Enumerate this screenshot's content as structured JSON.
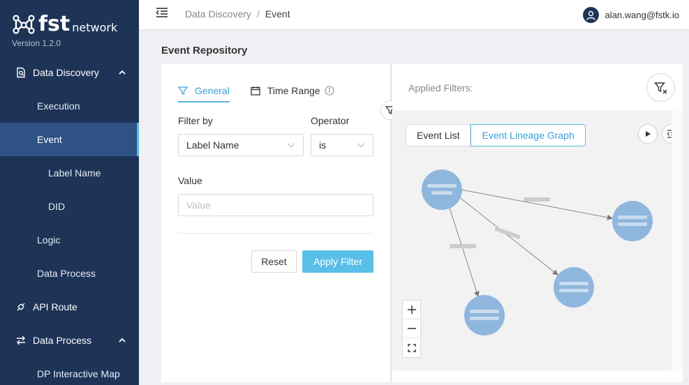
{
  "brand": {
    "name": "fst",
    "suffix": "network",
    "version": "Version 1.2.0"
  },
  "sidebar": {
    "items": [
      {
        "label": "Data Discovery",
        "level": "top",
        "icon": "search-doc-icon",
        "expanded": true
      },
      {
        "label": "Execution",
        "level": "sub"
      },
      {
        "label": "Event",
        "level": "sub",
        "active": true
      },
      {
        "label": "Label Name",
        "level": "sub2"
      },
      {
        "label": "DID",
        "level": "sub2"
      },
      {
        "label": "Logic",
        "level": "sub"
      },
      {
        "label": "Data Process",
        "level": "sub"
      },
      {
        "label": "API Route",
        "level": "top",
        "icon": "route-icon"
      },
      {
        "label": "Data Process",
        "level": "top",
        "icon": "process-icon",
        "expanded": true
      },
      {
        "label": "DP Interactive Map",
        "level": "sub"
      }
    ]
  },
  "header": {
    "breadcrumb": [
      "Data Discovery",
      "Event"
    ],
    "breadcrumb_sep": "/",
    "user_email": "alan.wang@fstk.io"
  },
  "page": {
    "title": "Event Repository"
  },
  "filter": {
    "tabs": [
      {
        "label": "General",
        "active": true
      },
      {
        "label": "Time Range"
      }
    ],
    "filter_by_label": "Filter by",
    "filter_by_value": "Label Name",
    "operator_label": "Operator",
    "operator_value": "is",
    "value_label": "Value",
    "value_placeholder": "Value",
    "reset_label": "Reset",
    "apply_label": "Apply Filter"
  },
  "results": {
    "applied_filters_label": "Applied Filters:",
    "view_tabs": [
      "Event List",
      "Event Lineage Graph"
    ],
    "active_view": "Event Lineage Graph"
  },
  "colors": {
    "sidebar_bg": "#1d3457",
    "accent": "#5abfe6",
    "node": "#8fb7de"
  }
}
